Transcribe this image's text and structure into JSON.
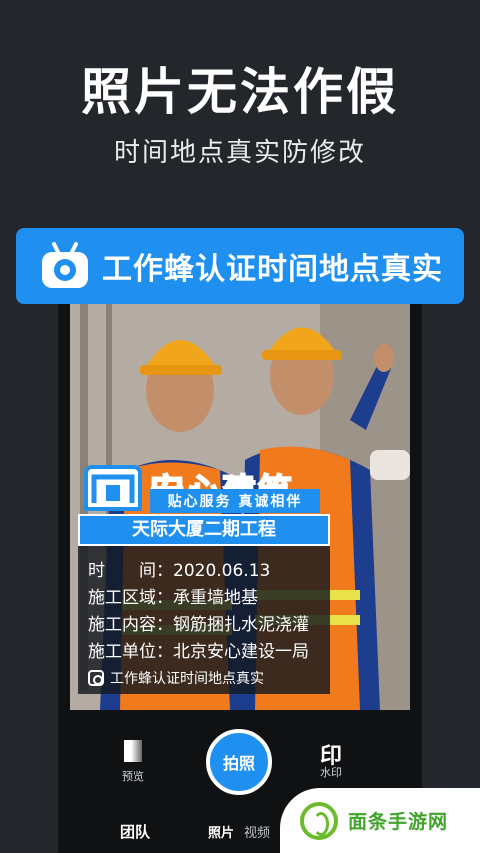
{
  "header": {
    "title": "照片无法作假",
    "subtitle": "时间地点真实防修改"
  },
  "banner": {
    "icon": "camera-bee-icon",
    "text": "工作蜂认证时间地点真实"
  },
  "watermark": {
    "brand_name": "安心建筑",
    "slogan": "贴心服务 真诚相伴",
    "project": "天际大厦二期工程",
    "rows": [
      {
        "label": "时　　间",
        "value": "2020.06.13"
      },
      {
        "label": "施工区域",
        "value": "承重墙地基"
      },
      {
        "label": "施工内容",
        "value": "钢筋捆扎水泥浇灌"
      },
      {
        "label": "施工单位",
        "value": "北京安心建设一局"
      }
    ],
    "footer": "工作蜂认证时间地点真实"
  },
  "controls": {
    "preview_label": "预览",
    "shutter_label": "拍照",
    "watermark_glyph": "印",
    "watermark_label": "水印"
  },
  "tabs": {
    "team": "团队",
    "photo": "照片",
    "video": "视频"
  },
  "site_badge": {
    "name": "面条手游网"
  },
  "colors": {
    "accent": "#1f8ff0",
    "background": "#23272c",
    "site_green": "#40a32a"
  }
}
